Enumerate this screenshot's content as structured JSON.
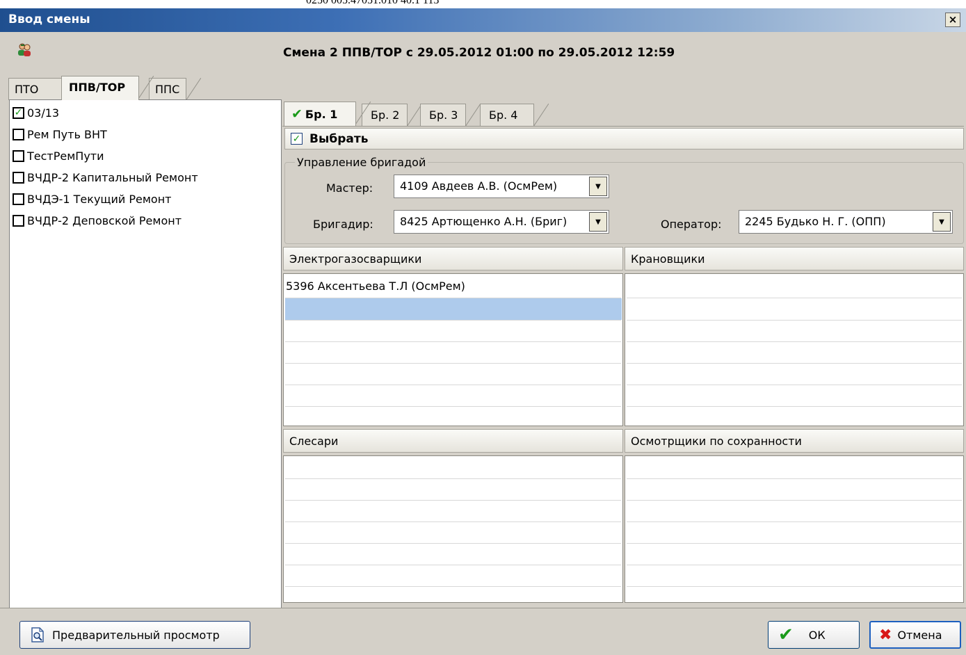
{
  "window": {
    "title": "Ввод смены",
    "top_strip_text": "0250 005.47051.010 40.1 113",
    "close_glyph": "×"
  },
  "heading": "Смена 2 ППВ/ТОР с 29.05.2012 01:00 по 29.05.2012 12:59",
  "left_tabs": [
    {
      "label": "ПТО",
      "active": false
    },
    {
      "label": "ППВ/ТОР",
      "active": true
    },
    {
      "label": "ППС",
      "active": false
    }
  ],
  "teams": [
    {
      "label": "03/13",
      "checked": true
    },
    {
      "label": "Рем Путь ВНТ",
      "checked": false
    },
    {
      "label": "ТестРемПути",
      "checked": false
    },
    {
      "label": "ВЧДР-2 Капитальный Ремонт",
      "checked": false
    },
    {
      "label": "ВЧДЭ-1 Текущий Ремонт",
      "checked": false
    },
    {
      "label": "ВЧДР-2 Деповской Ремонт",
      "checked": false
    }
  ],
  "brigade_tabs": [
    {
      "label": "Бр. 1",
      "active": true,
      "icon": "check-icon"
    },
    {
      "label": "Бр. 2",
      "active": false
    },
    {
      "label": "Бр. 3",
      "active": false
    },
    {
      "label": "Бр. 4",
      "active": false
    }
  ],
  "select": {
    "label": "Выбрать",
    "checked": true
  },
  "management": {
    "legend": "Управление бригадой",
    "master_label": "Мастер:",
    "master_value": "4109  Авдеев А.В. (ОсмРем)",
    "foreman_label": "Бригадир:",
    "foreman_value": "8425  Артющенко А.Н. (Бриг)",
    "operator_label": "Оператор:",
    "operator_value": "2245  Будько Н. Г. (ОПП)"
  },
  "grids": {
    "welders": {
      "header": "Электрогазосварщики",
      "rows": [
        "5396 Аксентьева Т.Л (ОсмРем)"
      ]
    },
    "crane": {
      "header": "Крановщики",
      "rows": []
    },
    "fitters": {
      "header": "Слесари",
      "rows": []
    },
    "inspectors": {
      "header": "Осмотрщики по сохранности",
      "rows": []
    }
  },
  "buttons": {
    "preview": "Предварительный просмотр",
    "ok": "ОК",
    "cancel": "Отмена"
  },
  "colors": {
    "accent_green": "#1a9a1a",
    "cancel_red": "#d81818",
    "selection": "#aecbec",
    "title_bar": "#1f4f8f"
  }
}
